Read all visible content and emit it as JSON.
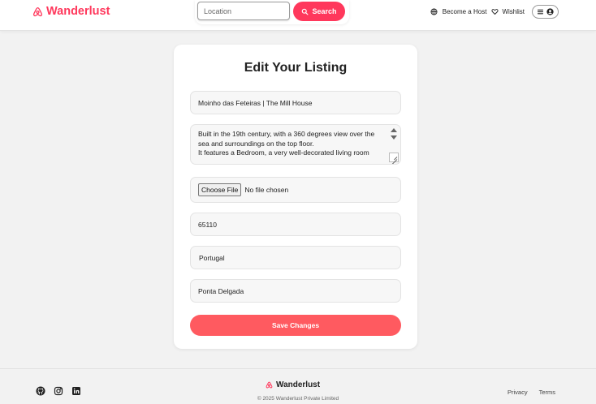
{
  "navbar": {
    "brand": "Wanderlust",
    "search": {
      "placeholder": "Location",
      "button_label": "Search"
    },
    "host_link": "Become a Host",
    "wishlist_link": "Wishlist"
  },
  "form": {
    "title": "Edit Your Listing",
    "listing_title": "Moinho das Feteiras | The Mill House",
    "description": "Built in the 19th century, with a 360 degrees view over the sea and surroundings on the top floor.\nIt features a Bedroom, a very well-decorated living room",
    "file_button": "Choose File",
    "file_status": "No file chosen",
    "price": "65110",
    "country": "Portugal",
    "location": "Ponta Delgada",
    "save_label": "Save Changes"
  },
  "footer": {
    "brand": "Wanderlust",
    "copyright": "© 2025 Wanderlust Private Limited",
    "links": {
      "privacy": "Privacy",
      "terms": "Terms"
    }
  },
  "colors": {
    "brand": "#ff385c",
    "save_button": "#ff5a60",
    "page_bg": "#f2f2f2"
  },
  "icons": {
    "brand": "airbnb-logo-icon",
    "search": "magnifying-glass-icon",
    "globe": "globe-icon",
    "wishlist": "heart-icon",
    "menu": "hamburger-menu-icon",
    "user": "user-circle-icon",
    "socials": [
      "github-icon",
      "instagram-icon",
      "linkedin-icon"
    ]
  }
}
